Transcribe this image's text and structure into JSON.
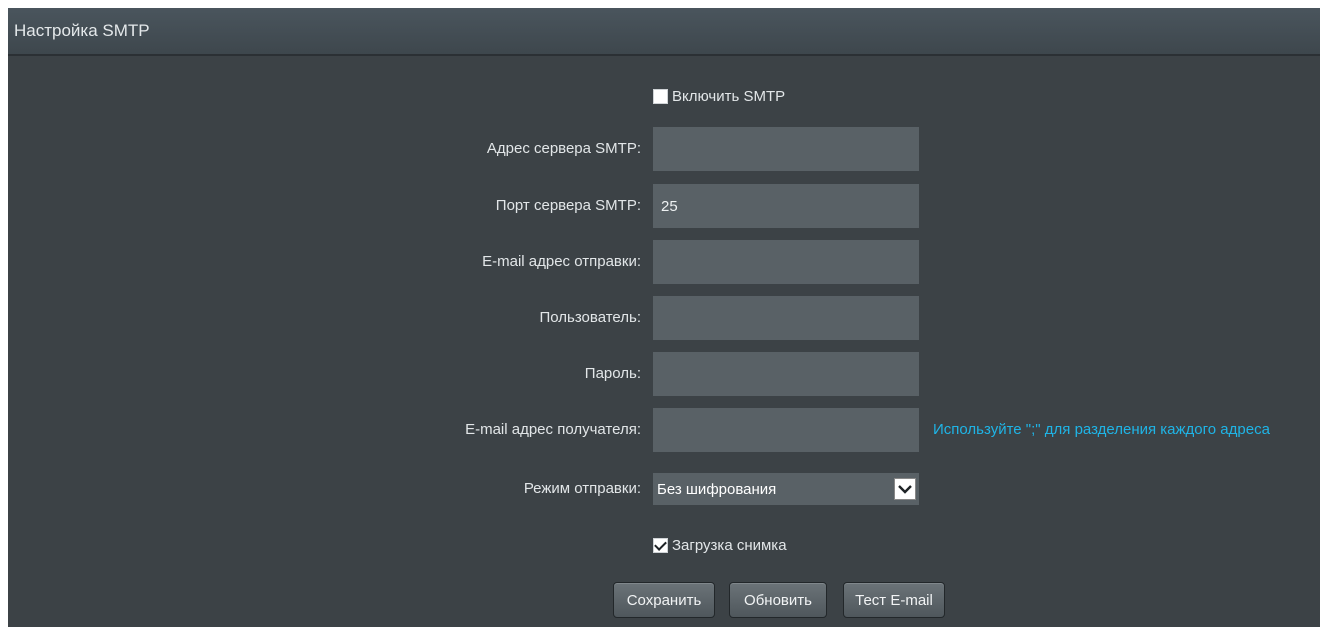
{
  "header": {
    "title": "Настройка SMTP"
  },
  "enable_smtp": {
    "label": "Включить SMTP",
    "checked": false
  },
  "fields": {
    "server_address": {
      "label": "Адрес сервера SMTP:",
      "value": ""
    },
    "server_port": {
      "label": "Порт сервера SMTP:",
      "value": "25"
    },
    "sender_email": {
      "label": "E-mail адрес отправки:",
      "value": ""
    },
    "user": {
      "label": "Пользователь:",
      "value": ""
    },
    "password": {
      "label": "Пароль:",
      "value": ""
    },
    "recipient_email": {
      "label": "E-mail адрес получателя:",
      "value": "",
      "hint": "Используйте \";\" для разделения каждого адреса"
    }
  },
  "send_mode": {
    "label": "Режим отправки:",
    "selected": "Без шифрования"
  },
  "upload_snapshot": {
    "label": "Загрузка снимка",
    "checked": true
  },
  "buttons": {
    "save": "Сохранить",
    "refresh": "Обновить",
    "test_email": "Тест E-mail"
  },
  "colors": {
    "panel_bg": "#3c4246",
    "field_bg": "#596166",
    "hint": "#1fb4e6"
  }
}
